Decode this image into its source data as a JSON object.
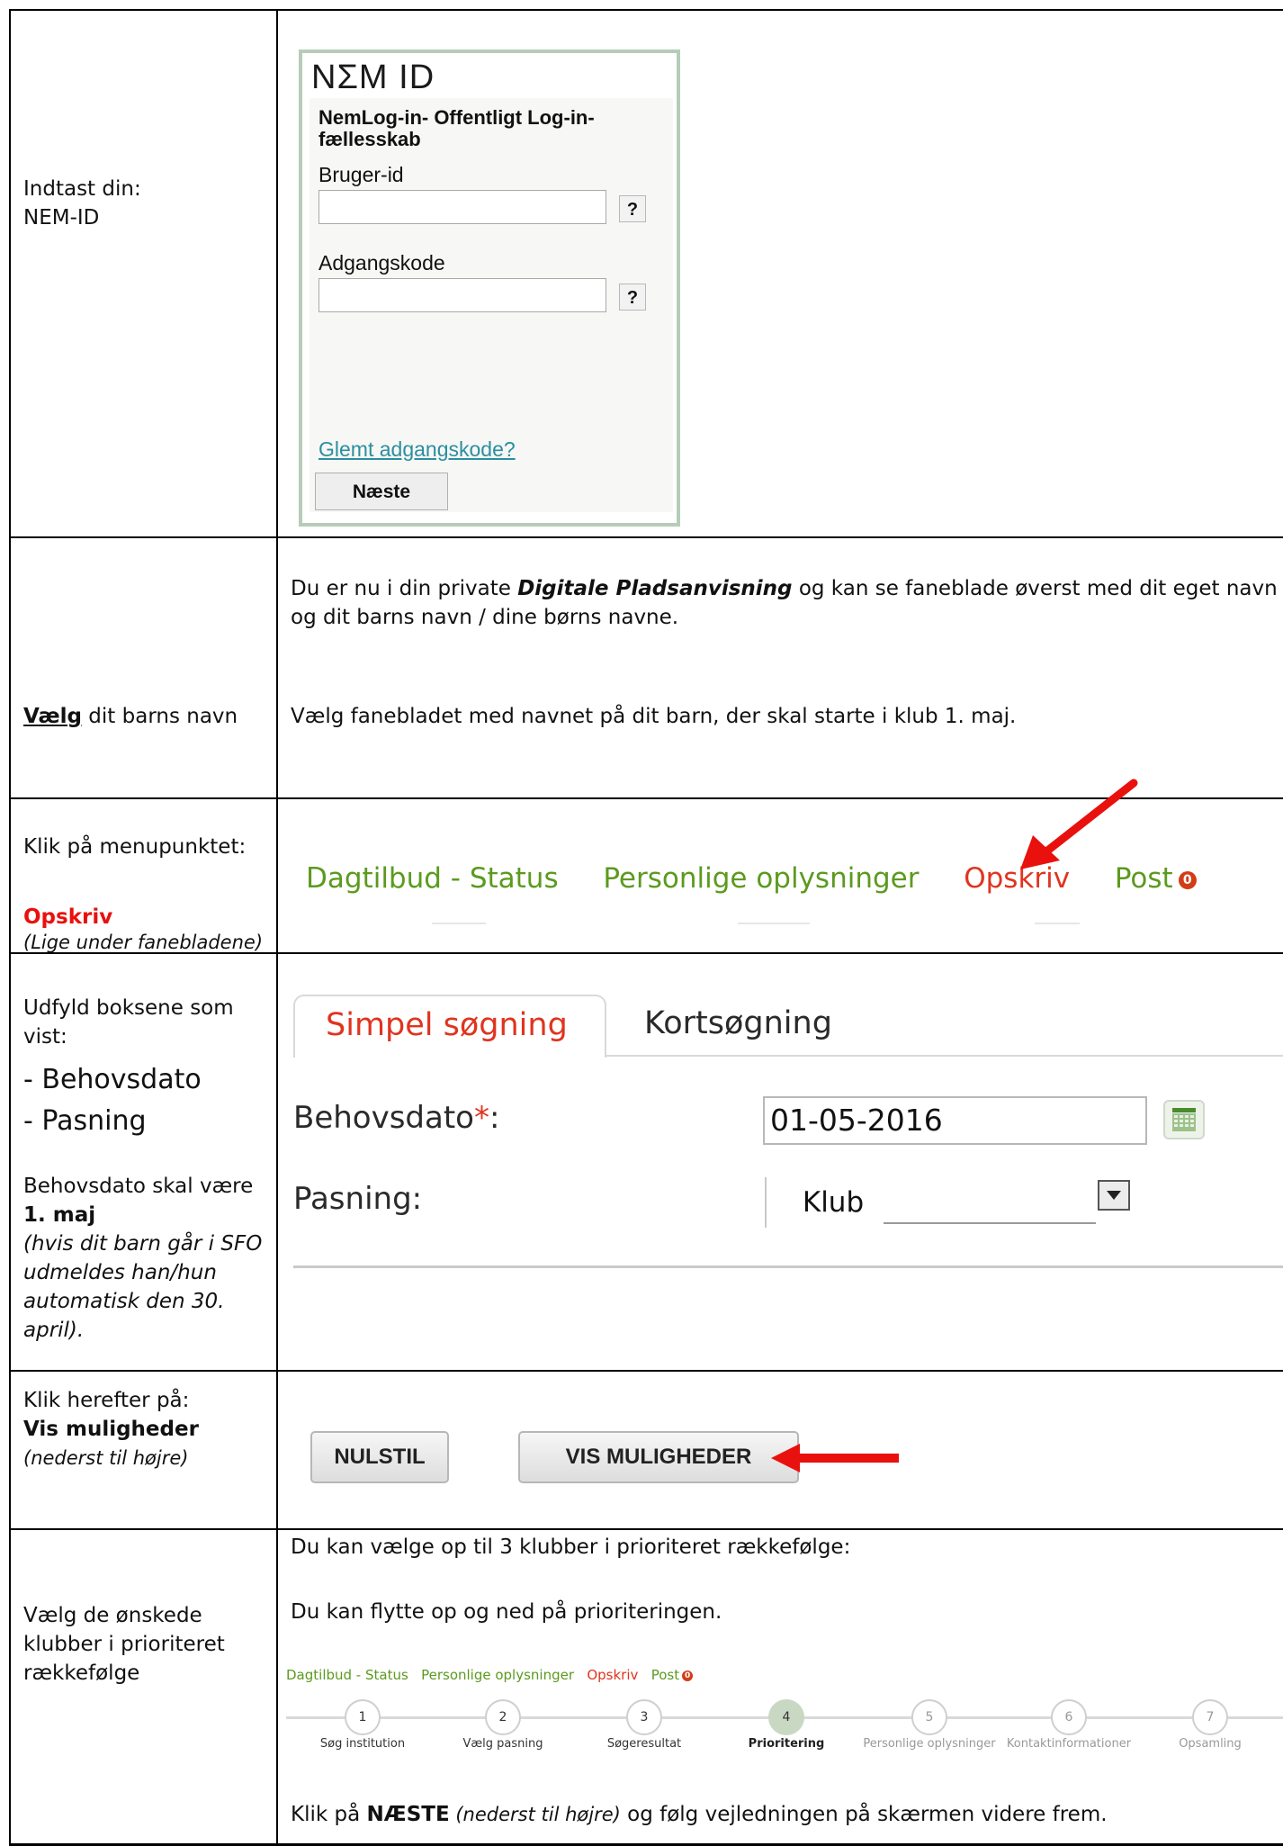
{
  "row1": {
    "left_line1": "Indtast din:",
    "left_line2": "NEM-ID",
    "nemid": {
      "logo": "NΣM ID",
      "title": "NemLog-in- Offentligt Log-in-fællesskab",
      "user_label": "Bruger-id",
      "user_value": "",
      "password_label": "Adgangskode",
      "password_value": "",
      "help": "?",
      "forgot_link": "Glemt adgangskode?",
      "next_button": "Næste"
    }
  },
  "row2": {
    "left_bold": "Vælg",
    "left_rest": " dit barns navn",
    "para1_a": "Du er nu i din private ",
    "para1_em": "Digitale Pladsanvisning",
    "para1_b": " og kan se faneblade øverst med dit eget navn",
    "para1_line2": "og dit barns navn / dine børns navne.",
    "para2": "Vælg fanebladet med navnet på dit barn, der skal starte i klub 1. maj."
  },
  "row3": {
    "left_line1": "Klik på menupunktet:",
    "left_red": "Opskriv",
    "left_note": "(Lige under fanebladene)",
    "menu": {
      "item1": "Dagtilbud - Status",
      "item2": "Personlige oplysninger",
      "item3": "Opskriv",
      "item4": "Post",
      "badge": "0"
    }
  },
  "row4": {
    "left_line1": "Udfyld boksene som",
    "left_line2": "vist:",
    "left_item1": "- Behovsdato",
    "left_item2": "- Pasning",
    "left_line3": "Behovsdato skal være",
    "left_bold": "1. maj",
    "left_note1": "(hvis dit barn går i SFO",
    "left_note2": "udmeldes han/hun",
    "left_note3": "automatisk den 30.",
    "left_note4": "april).",
    "form": {
      "tab_active": "Simpel søgning",
      "tab_inactive": "Kortsøgning",
      "date_label": "Behovsdato",
      "asterisk": "*",
      "colon": ":",
      "date_value": "01-05-2016",
      "pasning_label": "Pasning:",
      "pasning_value": "Klub"
    }
  },
  "row5": {
    "left_line1": "Klik herefter på:",
    "left_bold": "Vis muligheder",
    "left_note": "(nederst til højre)",
    "btn_reset": "NULSTIL",
    "btn_show": "VIS MULIGHEDER"
  },
  "row6": {
    "left_line1": "Vælg de ønskede",
    "left_line2": "klubber i prioriteret",
    "left_line3": "rækkefølge",
    "text1": "Du kan vælge op til 3 klubber i prioriteret rækkefølge:",
    "text2": "Du kan flytte op og ned på prioriteringen.",
    "crumbs": {
      "c1": "Dagtilbud - Status",
      "c2": "Personlige oplysninger",
      "c3": "Opskriv",
      "c4": "Post",
      "badge": "0"
    },
    "steps": [
      {
        "num": "1",
        "label": "Søg institution"
      },
      {
        "num": "2",
        "label": "Vælg pasning"
      },
      {
        "num": "3",
        "label": "Søgeresultat"
      },
      {
        "num": "4",
        "label": "Prioritering"
      },
      {
        "num": "5",
        "label": "Personlige oplysninger"
      },
      {
        "num": "6",
        "label": "Kontaktinformationer"
      },
      {
        "num": "7",
        "label": "Opsamling"
      }
    ],
    "final_a": "Klik på ",
    "final_bold": "NÆSTE",
    "final_italic": " (nederst til højre)",
    "final_b": " og følg vejledningen på skærmen videre frem."
  },
  "colors": {
    "arrow": "#e8110e",
    "menu_green": "#5c9a1e",
    "menu_red": "#e0341f"
  }
}
